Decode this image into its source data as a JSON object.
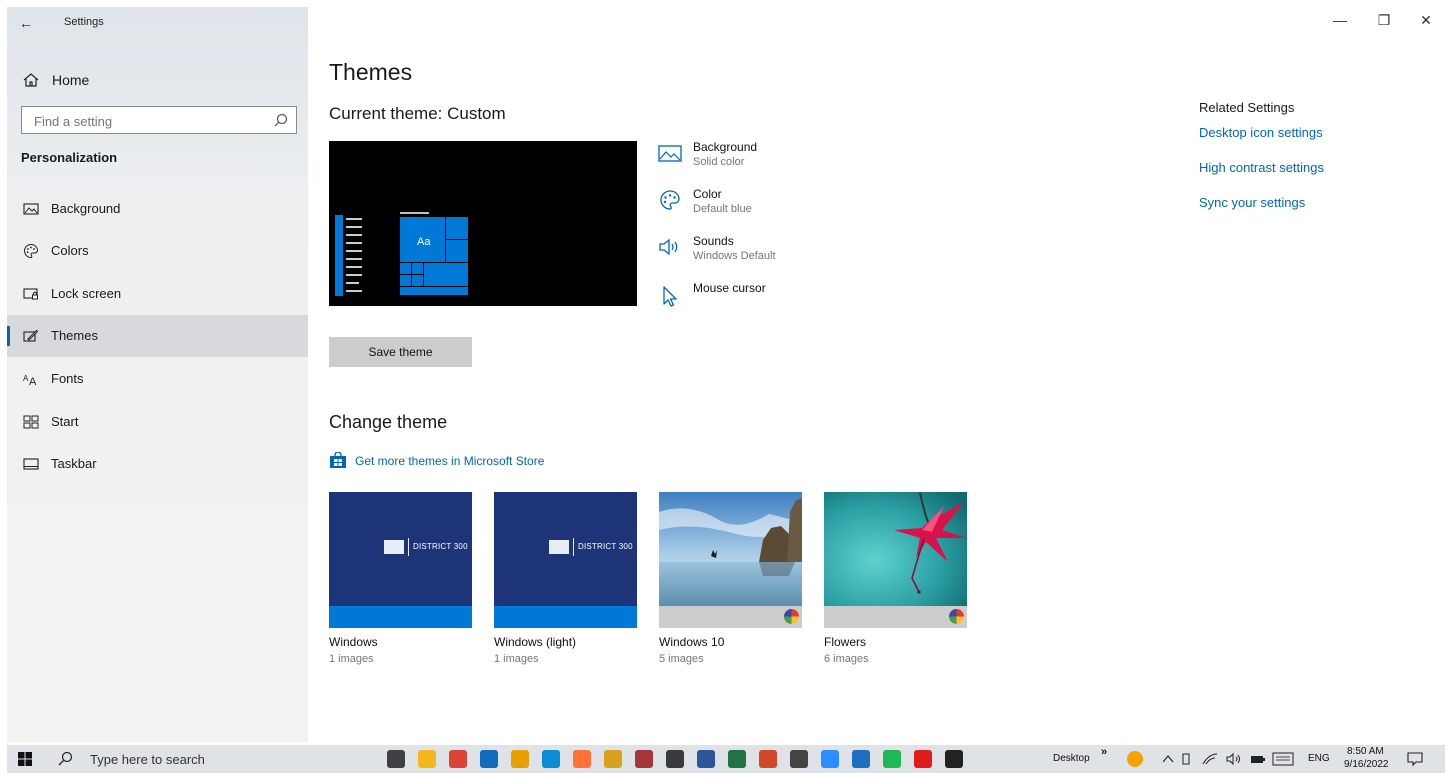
{
  "app": {
    "title": "Settings",
    "back_glyph": "←"
  },
  "window_controls": {
    "minimize": "—",
    "maximize": "❐",
    "close": "✕"
  },
  "sidebar": {
    "home_label": "Home",
    "search_placeholder": "Find a setting",
    "section_title": "Personalization",
    "items": [
      {
        "label": "Background",
        "icon": "picture-icon"
      },
      {
        "label": "Colors",
        "icon": "palette-icon"
      },
      {
        "label": "Lock screen",
        "icon": "lock-screen-icon"
      },
      {
        "label": "Themes",
        "icon": "themes-brush-icon",
        "active": true
      },
      {
        "label": "Fonts",
        "icon": "fonts-icon"
      },
      {
        "label": "Start",
        "icon": "start-grid-icon"
      },
      {
        "label": "Taskbar",
        "icon": "taskbar-icon"
      }
    ]
  },
  "main": {
    "title": "Themes",
    "current_theme": "Current theme: Custom",
    "preview": {
      "sample_text": "Aa",
      "accent_color": "#0078d7"
    },
    "properties": [
      {
        "title": "Background",
        "subtitle": "Solid color",
        "icon": "picture-icon"
      },
      {
        "title": "Color",
        "subtitle": "Default blue",
        "icon": "palette-icon"
      },
      {
        "title": "Sounds",
        "subtitle": "Windows Default",
        "icon": "speaker-icon"
      },
      {
        "title": "Mouse cursor",
        "subtitle": "",
        "icon": "cursor-icon"
      }
    ],
    "save_button": "Save theme",
    "change_title": "Change theme",
    "store_link": "Get more themes in Microsoft Store",
    "themes": [
      {
        "name": "Windows",
        "count": "1 images",
        "thumb_text": "DISTRICT 300",
        "accent": "#0078d7"
      },
      {
        "name": "Windows (light)",
        "count": "1 images",
        "thumb_text": "DISTRICT 300",
        "accent": "#0078d7"
      },
      {
        "name": "Windows 10",
        "count": "5 images",
        "accent": "#cccccc"
      },
      {
        "name": "Flowers",
        "count": "6 images",
        "accent": "#cccccc"
      }
    ]
  },
  "related": {
    "title": "Related Settings",
    "links": [
      "Desktop icon settings",
      "High contrast settings",
      "Sync your settings"
    ]
  },
  "taskbar": {
    "search_placeholder": "Type here to search",
    "desktop_label": "Desktop",
    "chevron": "»",
    "language": "ENG",
    "time": "8:50 AM",
    "date": "9/16/2022",
    "apps": [
      {
        "name": "task-view-icon",
        "color": "#404040"
      },
      {
        "name": "file-explorer-icon",
        "color": "#f2b81d"
      },
      {
        "name": "chrome-icon",
        "color": "#db4437"
      },
      {
        "name": "outlook-icon",
        "color": "#0f6cbd"
      },
      {
        "name": "charts-app-icon",
        "color": "#e6a100"
      },
      {
        "name": "edge-icon",
        "color": "#0c8bd6"
      },
      {
        "name": "firefox-icon",
        "color": "#ff7139"
      },
      {
        "name": "app-i-icon",
        "color": "#d9a21b"
      },
      {
        "name": "access-icon",
        "color": "#a4373a"
      },
      {
        "name": "calculator-icon",
        "color": "#3a3a3a"
      },
      {
        "name": "word-icon",
        "color": "#2b579a"
      },
      {
        "name": "excel-icon",
        "color": "#217346"
      },
      {
        "name": "powerpoint-icon",
        "color": "#d24726"
      },
      {
        "name": "snip-icon",
        "color": "#444444"
      },
      {
        "name": "zoom-icon",
        "color": "#2d8cff"
      },
      {
        "name": "slides-app-icon",
        "color": "#1e6fbf"
      },
      {
        "name": "spotify-icon",
        "color": "#1db954"
      },
      {
        "name": "acrobat-icon",
        "color": "#e01b1b"
      },
      {
        "name": "settings-gear-icon",
        "color": "#222222"
      }
    ]
  }
}
